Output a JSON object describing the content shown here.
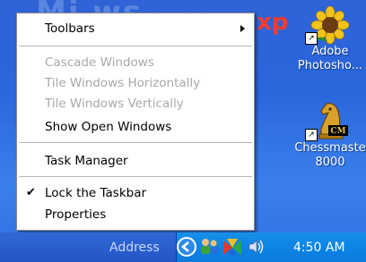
{
  "desktop": {
    "xp_text": "xp",
    "icons": [
      {
        "label_line1": "Adobe",
        "label_line2": "Photosho..."
      },
      {
        "label_line1": "Chessmaste",
        "label_line2": "8000"
      }
    ]
  },
  "context_menu": {
    "items": [
      {
        "label": "Toolbars",
        "disabled": false,
        "submenu": true
      },
      {
        "label": "Cascade Windows",
        "disabled": true
      },
      {
        "label": "Tile Windows Horizontally",
        "disabled": true
      },
      {
        "label": "Tile Windows Vertically",
        "disabled": true
      },
      {
        "label": "Show Open Windows",
        "disabled": false
      },
      {
        "label": "Task Manager",
        "disabled": false
      },
      {
        "label": "Lock the Taskbar",
        "disabled": false,
        "checked": true
      },
      {
        "label": "Properties",
        "disabled": false
      }
    ],
    "check_glyph": "✔"
  },
  "taskbar": {
    "address_label": "Address",
    "clock": "4:50 AM"
  },
  "colors": {
    "desktop_blue": "#2f66dc",
    "taskbar_blue": "#2a5fce",
    "tray_blue": "#0c84e4",
    "xp_red": "#ff3b2a"
  }
}
